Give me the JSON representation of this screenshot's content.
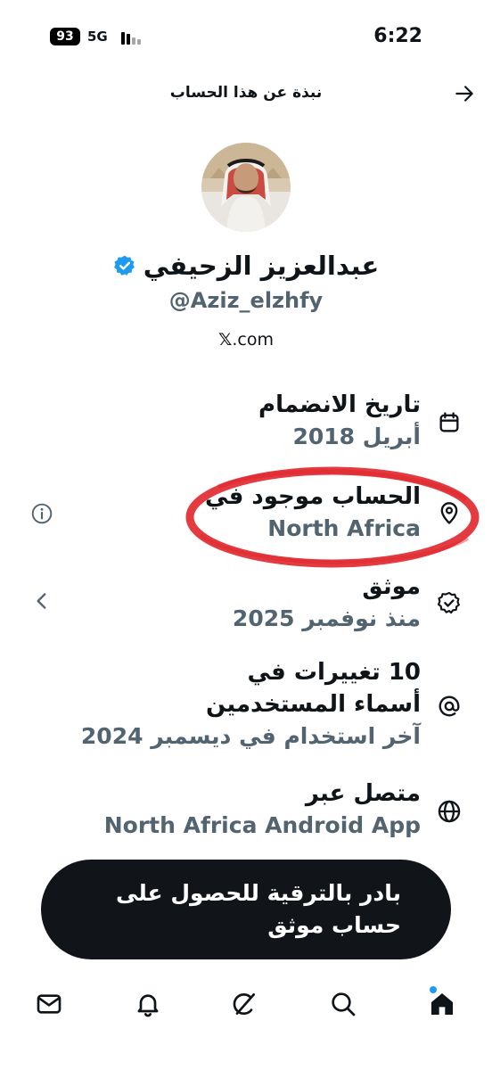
{
  "status_bar": {
    "battery": "93",
    "network": "5G",
    "time": "6:22"
  },
  "header": {
    "title": "نبذة عن هذا الحساب",
    "back_icon": "arrow-right-icon"
  },
  "profile": {
    "display_name": "عبدالعزيز الزحيفي",
    "handle": "@Aziz_elzhfy",
    "domain": ".com",
    "domain_logo": "𝕏",
    "verified": true
  },
  "info": {
    "joined": {
      "title": "تاريخ الانضمام",
      "value": "أبريل 2018",
      "icon": "calendar-icon"
    },
    "location": {
      "title": "الحساب موجود في",
      "value": "North Africa",
      "icon": "location-pin-icon",
      "side_icon": "info-icon"
    },
    "verified": {
      "title": "موثق",
      "value": "منذ نوفمبر 2025",
      "icon": "verified-check-icon",
      "side_icon": "chevron-left-icon"
    },
    "username_changes": {
      "title_line1": "10 تغييرات في",
      "title_line2": "أسماء المستخدمين",
      "value": "آخر استخدام في ديسمبر 2024",
      "icon": "at-sign-icon"
    },
    "connected": {
      "title": "متصل عبر",
      "value": "North Africa Android App",
      "icon": "globe-icon"
    }
  },
  "upgrade": {
    "line1": "بادر بالترقية للحصول على",
    "line2": "حساب موثق"
  },
  "tab_bar": {
    "items": [
      "mail-icon",
      "bell-icon",
      "grok-icon",
      "search-icon",
      "home-icon"
    ]
  },
  "colors": {
    "primary_text": "#0f1419",
    "secondary_text": "#536471",
    "accent": "#1d9bf0",
    "annotation": "#e0262b",
    "banner": "#111418"
  }
}
